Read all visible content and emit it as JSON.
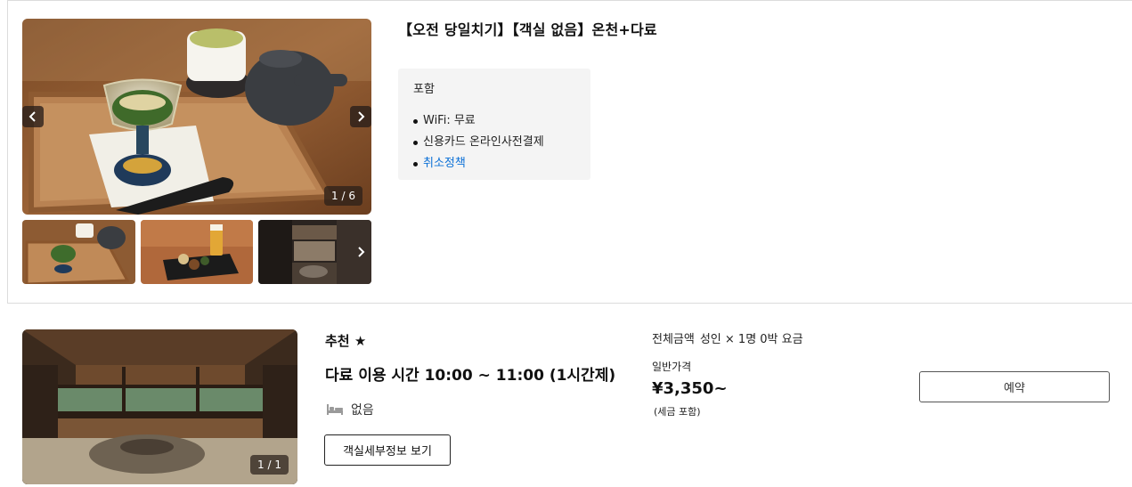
{
  "plan": {
    "title": "【오전 당일치기】【객실 없음】온천+다료",
    "gallery": {
      "counter": "1 / 6"
    },
    "includes": {
      "heading": "포함",
      "items": [
        {
          "label": "WiFi: 무료"
        },
        {
          "label": "신용카드 온라인사전결제"
        },
        {
          "label": "취소정책"
        }
      ]
    }
  },
  "room": {
    "gallery": {
      "counter": "1 / 1"
    },
    "recommend": "추천 ★",
    "name": "다료 이용 시간 10:00 ~ 11:00 (1시간제)",
    "bed": "없음",
    "details_button": "객실세부정보 보기",
    "price": {
      "summary_label": "전체금액",
      "summary_value": "성인 × 1명 0박 요금",
      "label": "일반가격",
      "value": "¥3,350~",
      "tax_note": "(세금 포함)"
    },
    "book_button": "예약"
  },
  "icons": {
    "prev": "chevron-left-icon",
    "next": "chevron-right-icon",
    "bed": "bed-icon"
  },
  "colors": {
    "link": "#0a6fd6",
    "include_bg": "#f4f4f4",
    "border": "#dcdcdc"
  }
}
